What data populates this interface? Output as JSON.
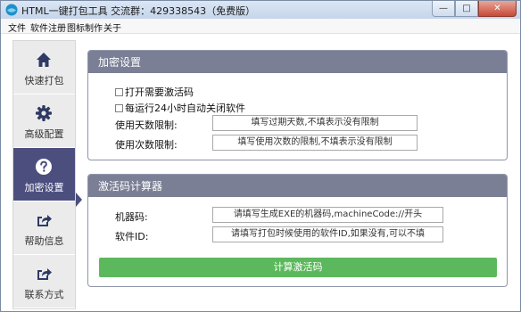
{
  "window": {
    "title": "HTML一键打包工具 交流群：429338543（免费版）",
    "min_glyph": "—",
    "max_glyph": "□",
    "close_glyph": "✕"
  },
  "menu": [
    "文件",
    "软件注册",
    "图标制作",
    "关于"
  ],
  "sidebar": {
    "items": [
      {
        "label": "快速打包",
        "icon": "home-icon"
      },
      {
        "label": "高级配置",
        "icon": "gear-icon"
      },
      {
        "label": "加密设置",
        "icon": "question-icon",
        "active": true
      },
      {
        "label": "帮助信息",
        "icon": "share-icon"
      },
      {
        "label": "联系方式",
        "icon": "share-icon"
      }
    ]
  },
  "encrypt_panel": {
    "title": "加密设置",
    "checkbox_activation": "打开需要激活码",
    "checkbox_autoclose": "每运行24小时自动关闭软件",
    "days_label": "使用天数限制:",
    "days_placeholder": "填写过期天数,不填表示没有限制",
    "times_label": "使用次数限制:",
    "times_placeholder": "填写使用次数的限制,不填表示没有限制"
  },
  "calc_panel": {
    "title": "激活码计算器",
    "machine_label": "机器码:",
    "machine_placeholder": "请填写生成EXE的机器码,machineCode://开头",
    "software_label": "软件ID:",
    "software_placeholder": "请填写打包时候使用的软件ID,如果没有,可以不填",
    "button_label": "计算激活码"
  },
  "colors": {
    "sidebar_active": "#4c4f7e",
    "panel_header": "#7b7f95",
    "calc_button": "#5cb85c"
  }
}
